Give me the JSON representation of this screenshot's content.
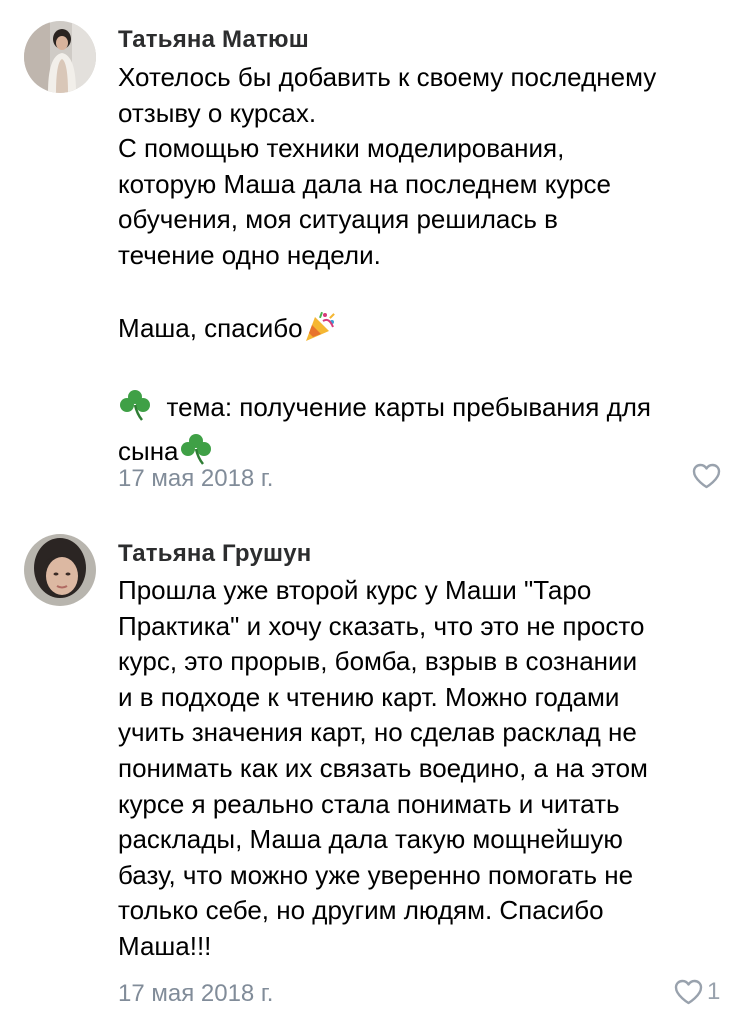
{
  "comments": [
    {
      "author": "Татьяна Матюш",
      "lines": [
        "Хотелось бы добавить к своему последнему",
        "отзыву о курсах.",
        "С помощью техники моделирования,",
        "которую Маша дала на последнем курсе",
        "обучения, моя ситуация решилась в",
        "течение одно недели."
      ],
      "thanks_line": "Маша, спасибо",
      "topic_line_1": "тема: получение карты пребывания для",
      "topic_line_2": "сына",
      "date": "17 мая 2018 г.",
      "like_icon": "heart-outline-icon",
      "like_count": ""
    },
    {
      "author": "Татьяна Грушун",
      "lines": [
        "Прошла уже второй курс у Маши \"Таро",
        "Практика\" и хочу сказать, что это не просто",
        "курс, это прорыв, бомба, взрыв в сознании",
        "и в подходе к чтению карт. Можно годами",
        "учить значения карт, но сделав расклад не",
        "понимать как их связать воедино, а на этом",
        "курсе я реально стала понимать и читать",
        "расклады, Маша дала такую мощнейшую",
        "базу, что можно уже уверенно помогать не",
        "только себе, но другим людям. Спасибо",
        "Маша!!!"
      ],
      "date": "17 мая 2018 г.",
      "like_icon": "heart-outline-icon",
      "like_count": "1"
    }
  ],
  "colors": {
    "author": "#2c2d2e",
    "date": "#818c99",
    "like": "#99a2ad"
  }
}
